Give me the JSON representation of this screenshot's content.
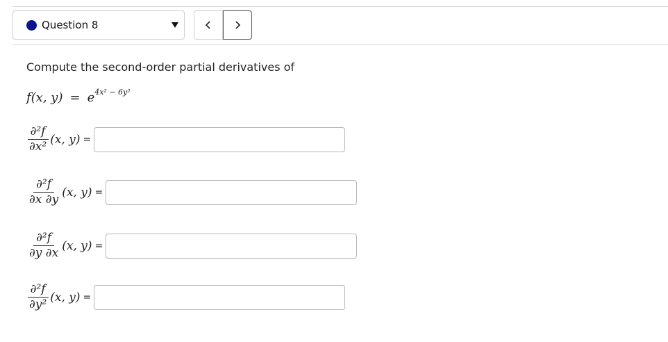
{
  "question_nav": {
    "label": "Question 8",
    "status_color": "#0b148f",
    "dropdown_icon": "caret-down-icon",
    "prev_icon": "chevron-left-icon",
    "next_icon": "chevron-right-icon"
  },
  "problem": {
    "prompt": "Compute the second-order partial derivatives of",
    "function": {
      "lhs": "f(x, y)",
      "equals": "=",
      "base": "e",
      "exponent": "4x² − 6y²"
    }
  },
  "derivatives": [
    {
      "numerator": "∂²f",
      "denominator": "∂x²",
      "args": "(x, y)",
      "equals": "=",
      "value": "",
      "placeholder": ""
    },
    {
      "numerator": "∂²f",
      "denominator": "∂x ∂y",
      "args": "(x, y)",
      "equals": "=",
      "value": "",
      "placeholder": ""
    },
    {
      "numerator": "∂²f",
      "denominator": "∂y ∂x",
      "args": "(x, y)",
      "equals": "=",
      "value": "",
      "placeholder": ""
    },
    {
      "numerator": "∂²f",
      "denominator": "∂y²",
      "args": "(x, y)",
      "equals": "=",
      "value": "",
      "placeholder": ""
    }
  ]
}
